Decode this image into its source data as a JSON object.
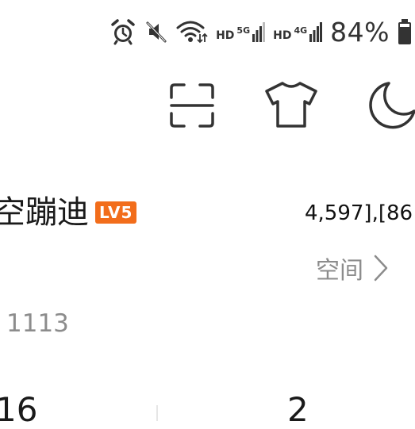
{
  "status_bar": {
    "network_1": {
      "hd": "HD",
      "gen": "5G"
    },
    "network_2": {
      "hd": "HD",
      "gen": "4G"
    },
    "battery_percent": "84%",
    "icons": [
      "alarm-icon",
      "mute-icon",
      "wifi-icon",
      "signal-icon",
      "battery-icon"
    ]
  },
  "toolbar": {
    "icons": [
      "scan-icon",
      "shirt-icon",
      "moon-icon"
    ]
  },
  "profile": {
    "nickname": "空蹦迪",
    "level_badge": "LV5",
    "stat_text": "4,597],[86",
    "number": "1113"
  },
  "space_link": {
    "label": "空间"
  },
  "counts": {
    "left": "16",
    "right": "2"
  },
  "colors": {
    "level_badge": "#f26d1b",
    "icon_stroke": "#333333",
    "muted_text": "#8c8c8c"
  }
}
